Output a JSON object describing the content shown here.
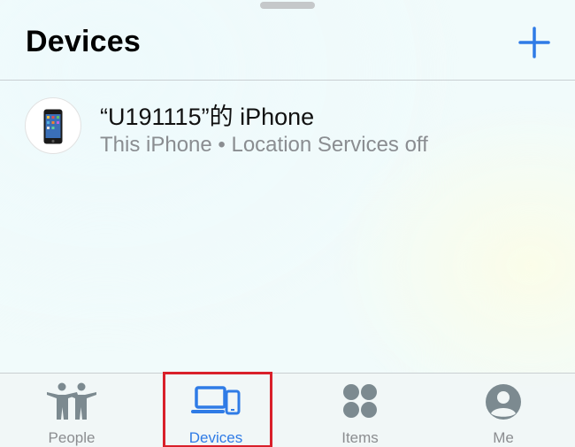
{
  "header": {
    "title": "Devices",
    "add_icon": "plus-icon"
  },
  "devices": [
    {
      "name": "“U191115”的 iPhone",
      "status": "This iPhone • Location Services off",
      "icon": "iphone-icon"
    }
  ],
  "tabbar": {
    "tabs": [
      {
        "label": "People",
        "icon": "people-icon",
        "active": false
      },
      {
        "label": "Devices",
        "icon": "devices-icon",
        "active": true
      },
      {
        "label": "Items",
        "icon": "items-icon",
        "active": false
      },
      {
        "label": "Me",
        "icon": "me-icon",
        "active": false
      }
    ]
  },
  "colors": {
    "accent": "#2f7be6",
    "inactive": "#8b8d90",
    "highlight": "#d9202a"
  }
}
